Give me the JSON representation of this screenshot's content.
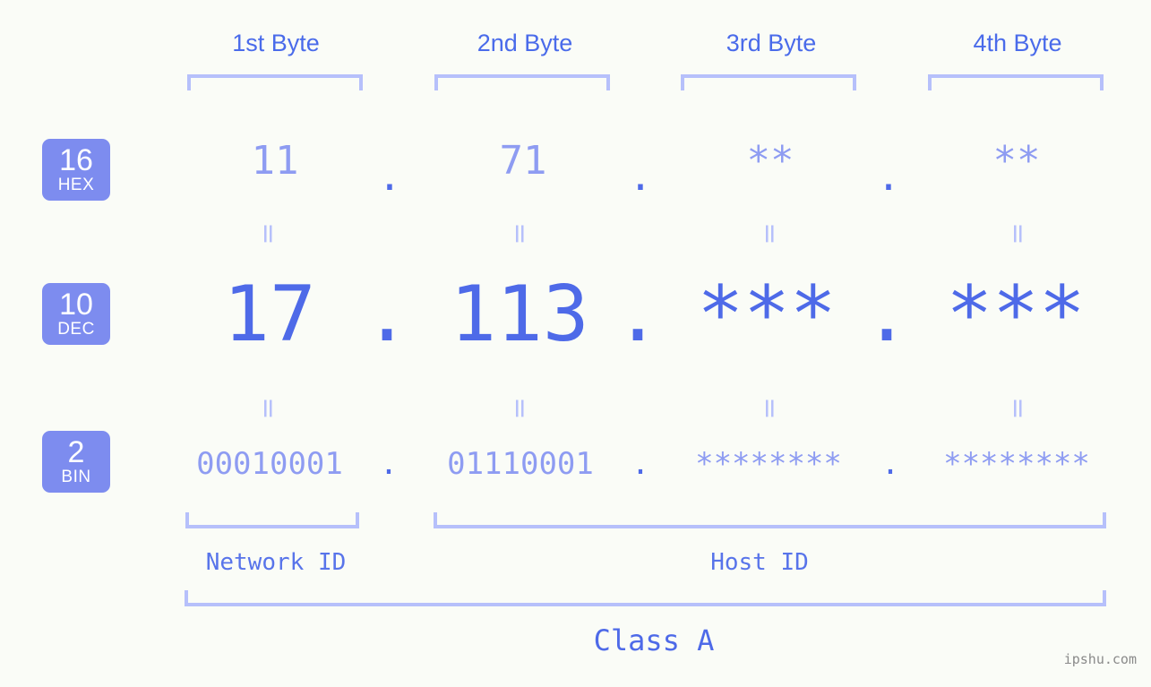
{
  "background_color": "#fafcf7",
  "colors": {
    "accent_strong": "#4e6ae8",
    "accent_light": "#8e9cf2",
    "bracket": "#b6c0fb",
    "badge_bg": "#7d8cef",
    "badge_text": "#ffffff",
    "watermark": "#8a8a8a"
  },
  "byte_headers": [
    {
      "label": "1st Byte"
    },
    {
      "label": "2nd Byte"
    },
    {
      "label": "3rd Byte"
    },
    {
      "label": "4th Byte"
    }
  ],
  "bases": [
    {
      "id": "hex",
      "number": "16",
      "abbr": "HEX"
    },
    {
      "id": "dec",
      "number": "10",
      "abbr": "DEC"
    },
    {
      "id": "bin",
      "number": "2",
      "abbr": "BIN"
    }
  ],
  "rows": {
    "hex": {
      "values": [
        "11",
        "71",
        "**",
        "**"
      ],
      "separators": [
        ".",
        ".",
        "."
      ]
    },
    "dec": {
      "values": [
        "17",
        "113",
        "***",
        "***"
      ],
      "separators": [
        ".",
        ".",
        "."
      ]
    },
    "bin": {
      "values": [
        "00010001",
        "01110001",
        "********",
        "********"
      ],
      "separators": [
        ".",
        ".",
        "."
      ]
    }
  },
  "equals_symbol": "=",
  "id_labels": {
    "network": "Network ID",
    "host": "Host ID"
  },
  "class_label": "Class A",
  "watermark": "ipshu.com"
}
